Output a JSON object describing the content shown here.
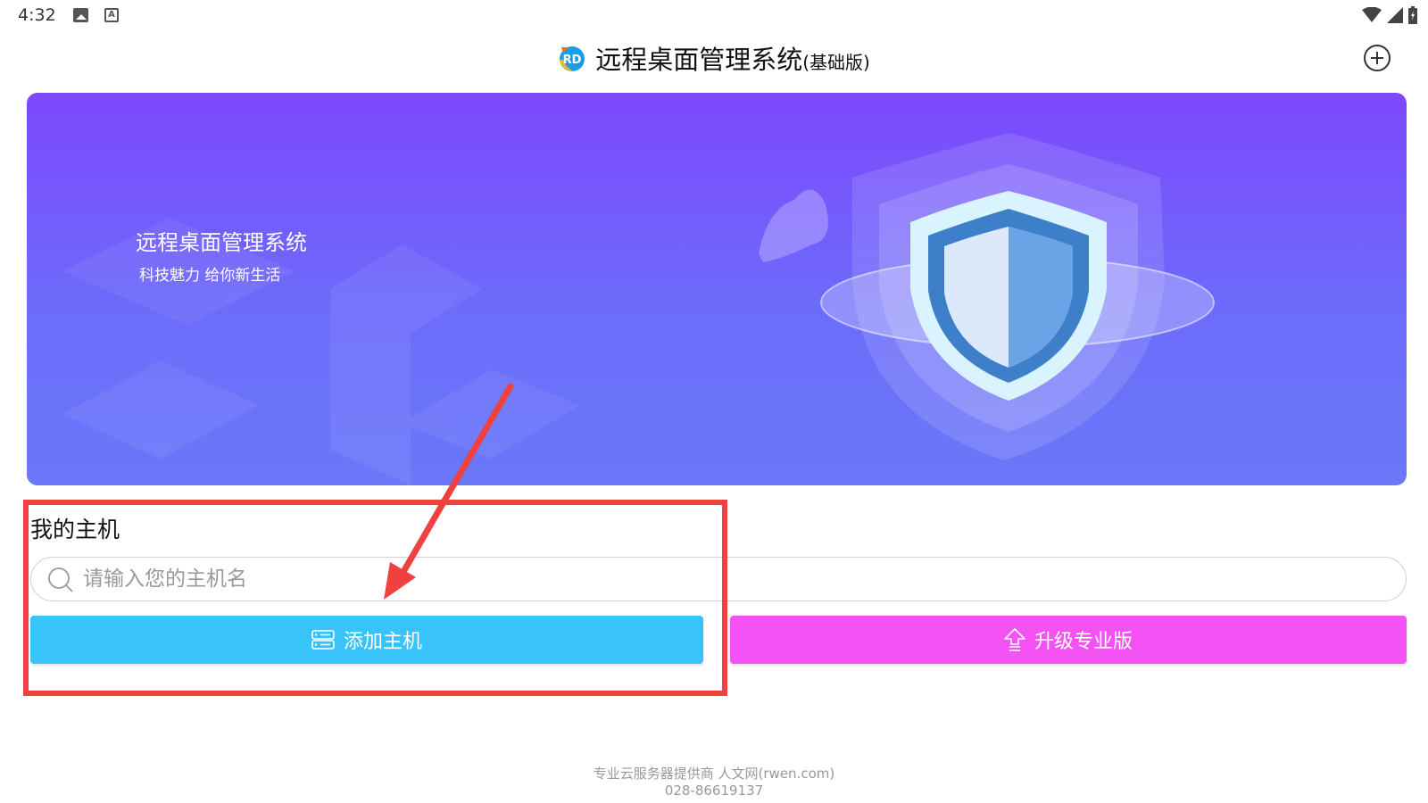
{
  "status_bar": {
    "time": "4:32",
    "icons": [
      "image-icon",
      "text-a-icon",
      "wifi-icon",
      "signal-icon",
      "battery-icon"
    ]
  },
  "header": {
    "title": "远程桌面管理系统",
    "edition": "(基础版)",
    "logo_text": "RD",
    "add_icon": "plus-circle-icon"
  },
  "banner": {
    "title": "远程桌面管理系统",
    "subtitle": "科技魅力 给你新生活",
    "art": "shield-icon"
  },
  "hosts": {
    "section_title": "我的主机",
    "search_placeholder": "请输入您的主机名",
    "add_button_label": "添加主机",
    "upgrade_button_label": "升级专业版"
  },
  "footer": {
    "line1": "专业云服务器提供商  人文网(rwen.com)",
    "line2": "028-86619137"
  },
  "colors": {
    "banner_top": "#7d48fc",
    "banner_bottom": "#6a78f9",
    "add_button": "#38c4fb",
    "upgrade_button": "#f552f5",
    "annotation_red": "#f04040"
  }
}
